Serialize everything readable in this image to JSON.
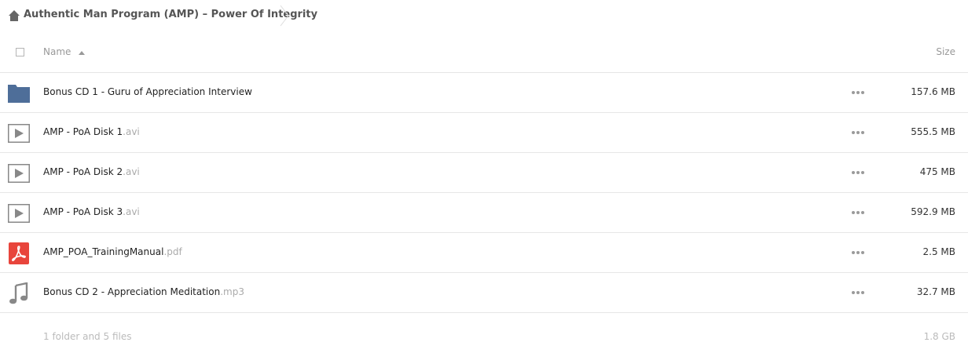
{
  "breadcrumb": {
    "title": "Authentic Man Program (AMP) – Power Of Integrity",
    "icon": "home-icon"
  },
  "header": {
    "name_label": "Name",
    "size_label": "Size"
  },
  "files": [
    {
      "name": "Bonus CD 1 - Guru of Appreciation Interview",
      "ext": "",
      "size": "157.6 MB",
      "icon": "folder-icon"
    },
    {
      "name": "AMP - PoA Disk 1",
      "ext": ".avi",
      "size": "555.5 MB",
      "icon": "video-icon"
    },
    {
      "name": "AMP - PoA Disk 2",
      "ext": ".avi",
      "size": "475 MB",
      "icon": "video-icon"
    },
    {
      "name": "AMP - PoA Disk 3",
      "ext": ".avi",
      "size": "592.9 MB",
      "icon": "video-icon"
    },
    {
      "name": "AMP_POA_TrainingManual",
      "ext": ".pdf",
      "size": "2.5 MB",
      "icon": "pdf-icon"
    },
    {
      "name": "Bonus CD 2 - Appreciation Meditation",
      "ext": ".mp3",
      "size": "32.7 MB",
      "icon": "music-icon"
    }
  ],
  "footer": {
    "summary": "1 folder and 5 files",
    "total": "1.8 GB"
  },
  "colors": {
    "folder": "#4e6e99",
    "pdf": "#e8453c",
    "icon_gray": "#888888"
  }
}
